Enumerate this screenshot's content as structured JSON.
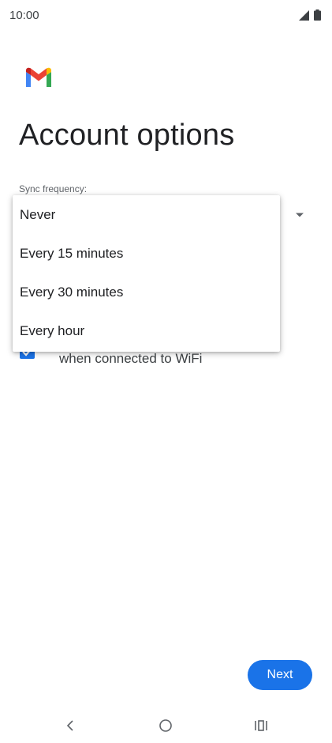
{
  "status_bar": {
    "time": "10:00",
    "icons": [
      "cell-signal-icon",
      "battery-icon"
    ]
  },
  "app": {
    "logo": "gmail-logo",
    "colors": {
      "accent": "#1a73e8",
      "text_primary": "#202124",
      "text_secondary": "#5f6368"
    }
  },
  "page": {
    "title": "Account options"
  },
  "sync": {
    "label": "Sync frequency:",
    "options": [
      "Never",
      "Every 15 minutes",
      "Every 30 minutes",
      "Every hour"
    ]
  },
  "wifi_checkbox": {
    "checked": true,
    "label": "when connected to WiFi"
  },
  "footer": {
    "next_label": "Next"
  },
  "nav": {
    "icons": [
      "back-icon",
      "home-icon",
      "recents-icon"
    ]
  }
}
